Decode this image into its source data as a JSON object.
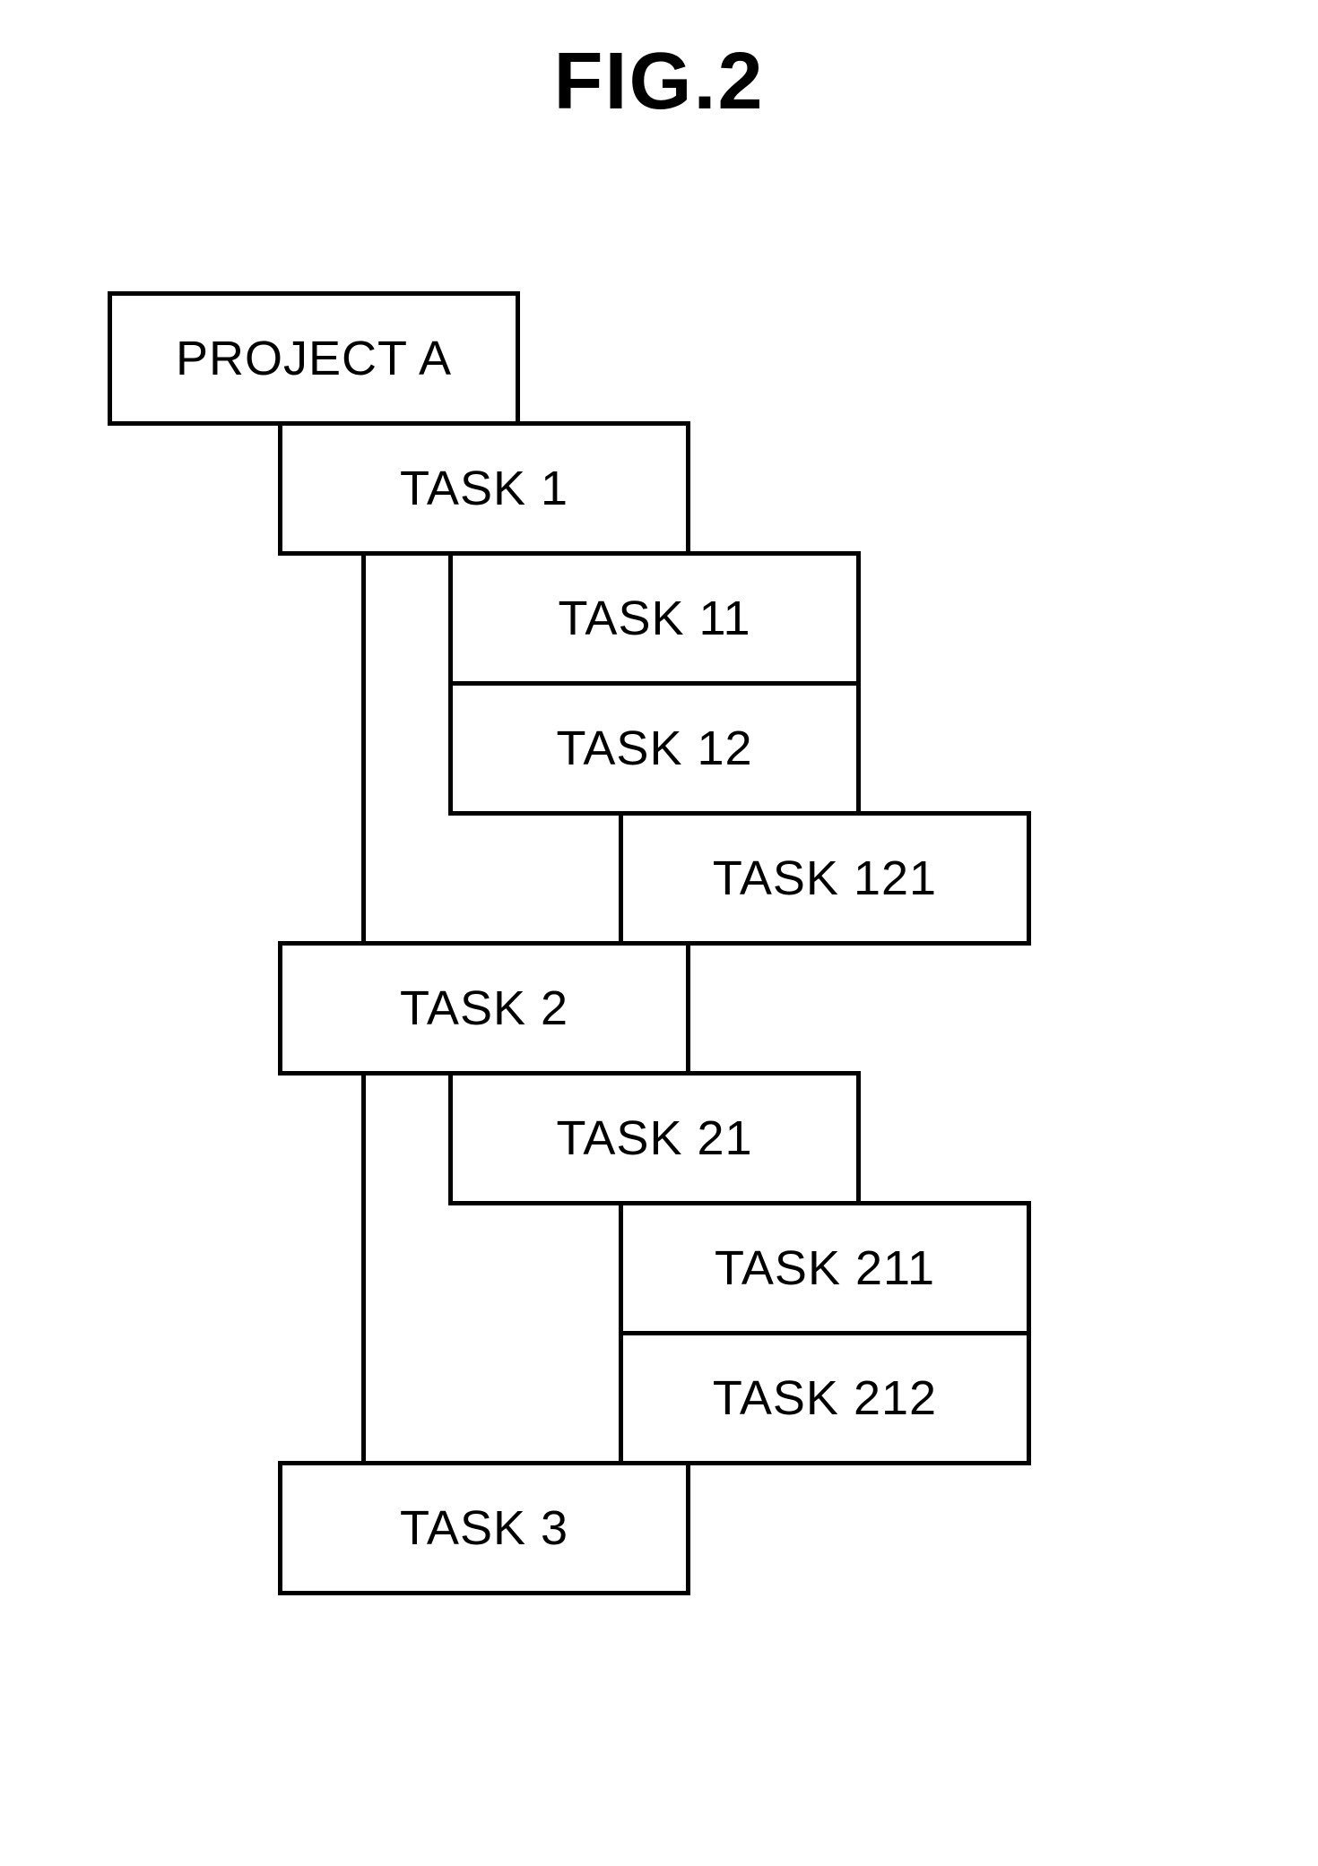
{
  "figure": {
    "title": "FIG.2"
  },
  "tree": {
    "root": {
      "label": "PROJECT A"
    },
    "children": [
      {
        "label": "TASK 1",
        "children": [
          {
            "label": "TASK 11"
          },
          {
            "label": "TASK 12",
            "children": [
              {
                "label": "TASK 121"
              }
            ]
          }
        ]
      },
      {
        "label": "TASK 2",
        "children": [
          {
            "label": "TASK 21",
            "children": [
              {
                "label": "TASK 211"
              },
              {
                "label": "TASK 212"
              }
            ]
          }
        ]
      },
      {
        "label": "TASK 3"
      }
    ]
  }
}
